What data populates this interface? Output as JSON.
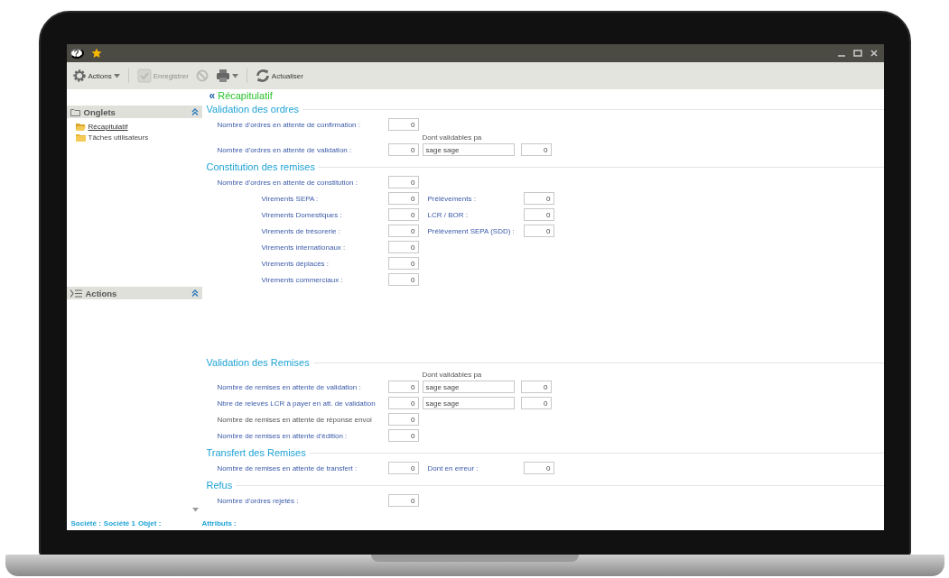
{
  "window": {
    "help_glyph": "?"
  },
  "toolbar": [
    {
      "kind": "actions",
      "label": "Actions",
      "disabled": false,
      "dropdown": true
    },
    {
      "kind": "save",
      "label": "Enregistrer",
      "disabled": true,
      "dropdown": false
    },
    {
      "kind": "cancel",
      "disabled": true,
      "dropdown": false
    },
    {
      "kind": "print",
      "disabled": false,
      "dropdown": true
    },
    {
      "kind": "refresh",
      "label": "Actualiser",
      "disabled": false,
      "dropdown": false
    }
  ],
  "sidebar": {
    "panels": [
      {
        "kind": "tabs",
        "title": "Onglets",
        "items": [
          {
            "label": "Récapitulatif",
            "selected": true
          },
          {
            "label": "Tâches utilisateurs",
            "selected": false
          }
        ]
      },
      {
        "kind": "actions",
        "title": "Actions"
      }
    ]
  },
  "content": {
    "back_glyph": "«",
    "title": "Récapitulatif",
    "sections": [
      {
        "title": "Validation des ordres",
        "rows": [
          {
            "kind": "field",
            "label": "Nombre d'ordres en attente de confirmation :",
            "value": "0",
            "muted": false
          },
          {
            "kind": "note",
            "label": "Dont validables pa"
          },
          {
            "kind": "field",
            "label": "Nombre d'ordres en attente de validation :",
            "value": "0",
            "validator": "sage sage",
            "validator_count": "0",
            "muted": false
          }
        ]
      },
      {
        "title": "Constitution des remises",
        "rows": [
          {
            "kind": "field",
            "label": "Nombre d'ordres en attente de constitution :",
            "value": "0",
            "muted": false,
            "children": [
              {
                "kind": "field",
                "label": "Virements SEPA :",
                "value": "0",
                "side_label": "Prélèvements :",
                "side_value": "0",
                "muted": false
              },
              {
                "kind": "field",
                "label": "Virements Domestiques :",
                "value": "0",
                "side_label": "LCR / BOR :",
                "side_value": "0",
                "muted": false
              },
              {
                "kind": "field",
                "label": "Virements de trésorerie :",
                "value": "0",
                "side_label": "Prélèvement SEPA (SDD) :",
                "side_value": "0",
                "muted": false
              },
              {
                "kind": "field",
                "label": "Virements internationaux :",
                "value": "0",
                "muted": false
              },
              {
                "kind": "field",
                "label": "Virements déplacés :",
                "value": "0",
                "muted": false
              },
              {
                "kind": "field",
                "label": "Virements commerciaux :",
                "value": "0",
                "muted": false
              }
            ]
          }
        ]
      },
      {
        "title": "Validation des Remises",
        "rows": [
          {
            "kind": "note",
            "label": "Dont validables pa"
          },
          {
            "kind": "field",
            "label": "Nombre de remises en attente de validation :",
            "value": "0",
            "validator": "sage sage",
            "validator_count": "0",
            "muted": false
          },
          {
            "kind": "field",
            "label": "Nbre de relevés LCR à payer en att. de validation",
            "value": "0",
            "validator": "sage sage",
            "validator_count": "0",
            "muted": false
          },
          {
            "kind": "field",
            "label": "Nombre de remises en attente de réponse envoi",
            "value": "0",
            "muted": true
          },
          {
            "kind": "field",
            "label": "Nombre de remises en attente d'édition :",
            "value": "0",
            "muted": false
          }
        ]
      },
      {
        "title": "Transfert des Remises",
        "rows": [
          {
            "kind": "field",
            "label": "Nombre de remises en attente de transfert :",
            "value": "0",
            "side_label": "Dont en erreur :",
            "side_value": "0",
            "muted": false
          }
        ]
      },
      {
        "title": "Refus",
        "rows": [
          {
            "kind": "field",
            "label": "Nombre d'ordres rejetés :",
            "value": "0",
            "muted": false
          }
        ]
      }
    ]
  },
  "status_bar": {
    "company_label": "Société :",
    "company": "Société 1",
    "object_label": "Objet :",
    "attributes_label": "Attributs :"
  }
}
